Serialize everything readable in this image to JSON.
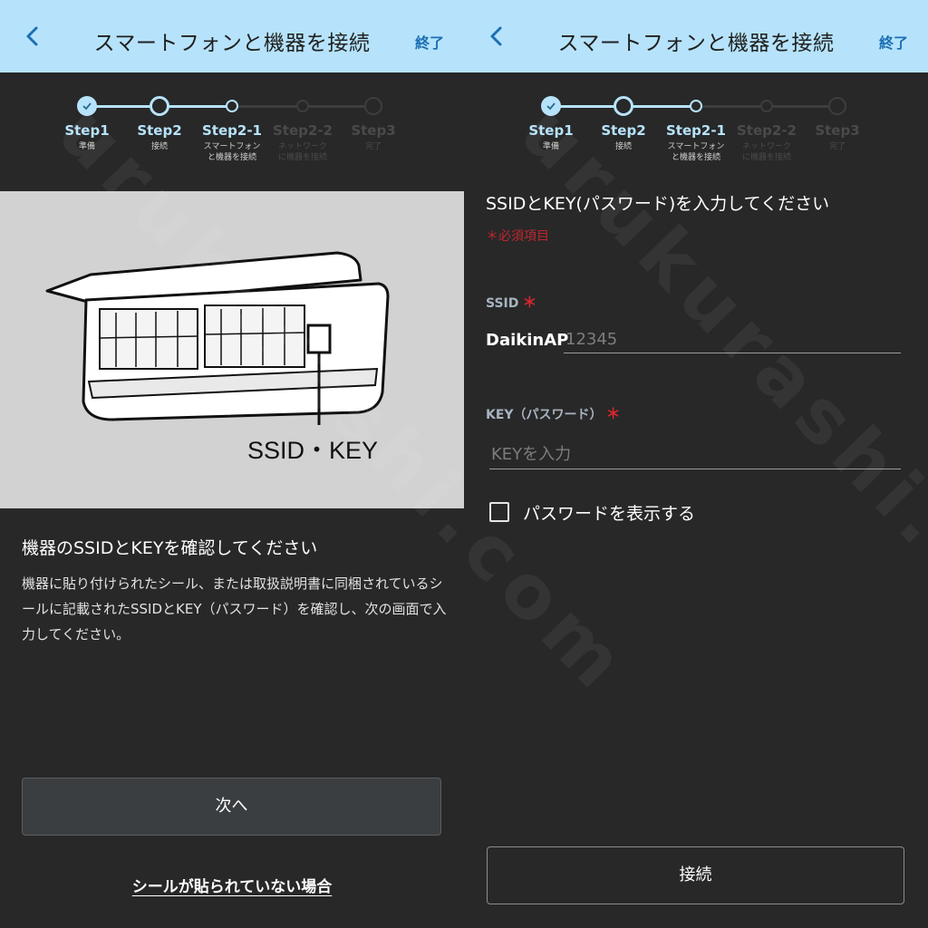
{
  "header": {
    "title": "スマートフォンと機器を接続",
    "finish_label": "終了"
  },
  "steps": [
    {
      "label": "Step1",
      "sub": "準備",
      "state": "done"
    },
    {
      "label": "Step2",
      "sub": "接続",
      "state": "current"
    },
    {
      "label": "Step2-1",
      "sub": "スマートフォン\nと機器を接続",
      "state": "active"
    },
    {
      "label": "Step2-2",
      "sub": "ネットワーク\nに機器を接続",
      "state": "todo"
    },
    {
      "label": "Step3",
      "sub": "完了",
      "state": "todo"
    }
  ],
  "left": {
    "callout": "SSID・KEY",
    "heading": "機器のSSIDとKEYを確認してください",
    "description": "機器に貼り付けられたシール、または取扱説明書に同梱されているシールに記載されたSSIDとKEY（パスワード）を確認し、次の画面で入力してください。",
    "next_label": "次へ",
    "no_seal_link": "シールが貼られていない場合"
  },
  "right": {
    "heading": "SSIDとKEY(パスワード)を入力してください",
    "required_note": "＊必須項目",
    "ssid_label": "SSID",
    "required_mark": "＊",
    "ssid_prefix": "DaikinAP",
    "ssid_placeholder": "12345",
    "key_label": "KEY（パスワード）",
    "key_placeholder": "KEYを入力",
    "show_password_label": "パスワードを表示する",
    "show_password_checked": false,
    "connect_label": "接続"
  },
  "watermark": "urukurashi.com",
  "colors": {
    "header_bg": "#b6e3fb",
    "accent": "#b6e3fb",
    "link_blue": "#1c6fb3",
    "required_red": "#d7262e",
    "panel_bg": "#282828"
  }
}
